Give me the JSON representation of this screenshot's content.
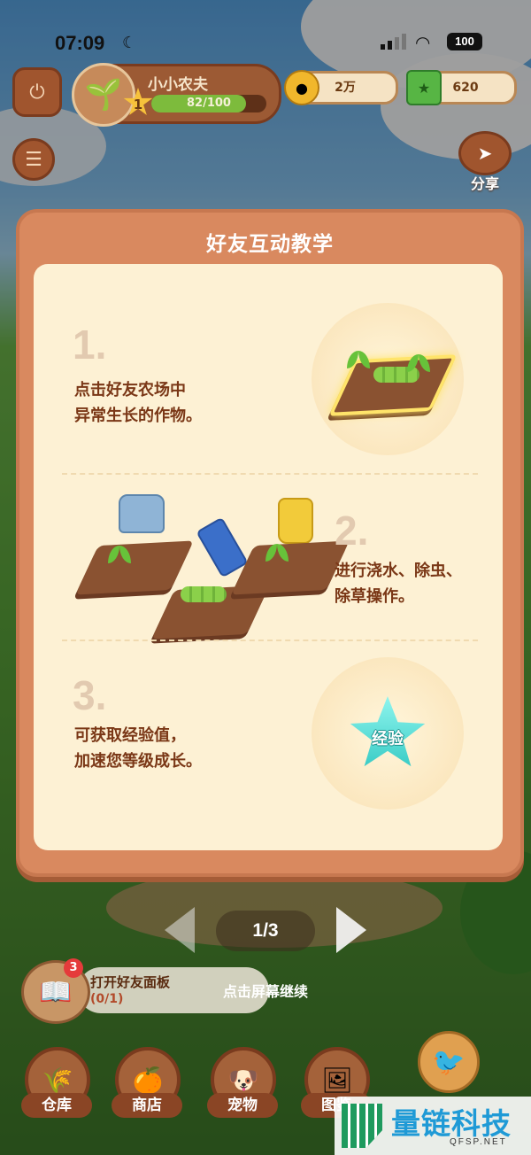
{
  "status_bar": {
    "time": "07:09",
    "battery": "100"
  },
  "player": {
    "name": "小小农夫",
    "level": "1",
    "xp_text": "82/100",
    "xp_fraction": 0.82
  },
  "currencies": [
    {
      "icon": "gold-coin-icon",
      "value": "2万"
    },
    {
      "icon": "cash-icon",
      "value": "620"
    }
  ],
  "share": {
    "label": "分享"
  },
  "tutorial": {
    "title": "好友互动教学",
    "steps": [
      {
        "number": "1.",
        "line1": "点击好友农场中",
        "line2": "异常生长的作物。"
      },
      {
        "number": "2.",
        "line1": "进行浇水、除虫、",
        "line2": "除草操作。"
      },
      {
        "number": "3.",
        "line1": "可获取经验值，",
        "line2": "加速您等级成长。"
      }
    ],
    "xp_badge": "经验"
  },
  "pager": {
    "text": "1/3",
    "current": 1,
    "total": 3
  },
  "quest": {
    "badge": "3",
    "title": "打开好友面板",
    "progress": "(0/1)"
  },
  "tap_hint": "点击屏幕继续",
  "bottom_nav": [
    {
      "label": "仓库"
    },
    {
      "label": "商店"
    },
    {
      "label": "宠物"
    },
    {
      "label": "图鉴"
    }
  ],
  "watermark": {
    "title": "量链科技",
    "sub": "QFSP.NET"
  },
  "colors": {
    "modal": "#d9895f",
    "panel": "#fdf1d4",
    "text_brown": "#7a3716",
    "step_number": "#e2cab0"
  }
}
